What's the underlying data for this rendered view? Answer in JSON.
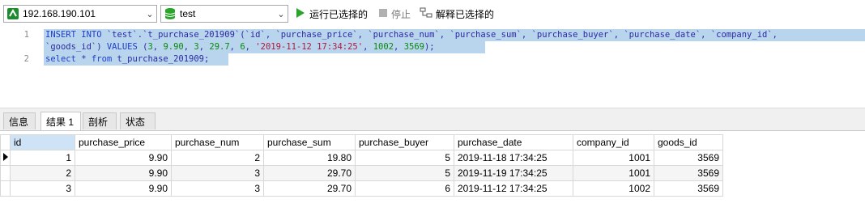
{
  "toolbar": {
    "connection": "192.168.190.101",
    "database": "test",
    "run_selected": "运行已选择的",
    "stop": "停止",
    "explain_selected": "解释已选择的",
    "colors": {
      "connection_icon": "#1e8c2e",
      "database_icon": "#2aa52a",
      "run_icon": "#2aa52a"
    }
  },
  "editor": {
    "line_numbers": [
      "1",
      "",
      "2"
    ],
    "line1_segments": [
      {
        "t": "INSERT INTO ",
        "c": "kw"
      },
      {
        "t": "`test`.`t_purchase_201909`(`id`, `purchase_price`, `purchase_num`, `purchase_sum`, `purchase_buyer`, `purchase_date`, `company_id`,",
        "c": "plain"
      }
    ],
    "line1_wrap_segments": [
      {
        "t": "`goods_id`) ",
        "c": "plain"
      },
      {
        "t": "VALUES ",
        "c": "kw"
      },
      {
        "t": "(",
        "c": "plain"
      },
      {
        "t": "3",
        "c": "num"
      },
      {
        "t": ", ",
        "c": "plain"
      },
      {
        "t": "9.90",
        "c": "num"
      },
      {
        "t": ", ",
        "c": "plain"
      },
      {
        "t": "3",
        "c": "num"
      },
      {
        "t": ", ",
        "c": "plain"
      },
      {
        "t": "29.7",
        "c": "num"
      },
      {
        "t": ", ",
        "c": "plain"
      },
      {
        "t": "6",
        "c": "num"
      },
      {
        "t": ", ",
        "c": "plain"
      },
      {
        "t": "'2019-11-12 17:34:25'",
        "c": "str"
      },
      {
        "t": ", ",
        "c": "plain"
      },
      {
        "t": "1002",
        "c": "num"
      },
      {
        "t": ", ",
        "c": "plain"
      },
      {
        "t": "3569",
        "c": "num"
      },
      {
        "t": ");",
        "c": "plain"
      }
    ],
    "line2_segments": [
      {
        "t": "select ",
        "c": "kw"
      },
      {
        "t": "* ",
        "c": "plain"
      },
      {
        "t": "from ",
        "c": "kw"
      },
      {
        "t": "t_purchase_201909;",
        "c": "plain"
      }
    ]
  },
  "tabs": [
    "信息",
    "结果 1",
    "剖析",
    "状态"
  ],
  "active_tab": 1,
  "grid": {
    "columns": [
      "id",
      "purchase_price",
      "purchase_num",
      "purchase_sum",
      "purchase_buyer",
      "purchase_date",
      "company_id",
      "goods_id"
    ],
    "rows": [
      [
        "1",
        "9.90",
        "2",
        "19.80",
        "5",
        "2019-11-18 17:34:25",
        "1001",
        "3569"
      ],
      [
        "2",
        "9.90",
        "3",
        "29.70",
        "5",
        "2019-11-19 17:34:25",
        "1001",
        "3569"
      ],
      [
        "3",
        "9.90",
        "3",
        "29.70",
        "6",
        "2019-11-12 17:34:25",
        "1002",
        "3569"
      ]
    ],
    "current_row": 0
  }
}
